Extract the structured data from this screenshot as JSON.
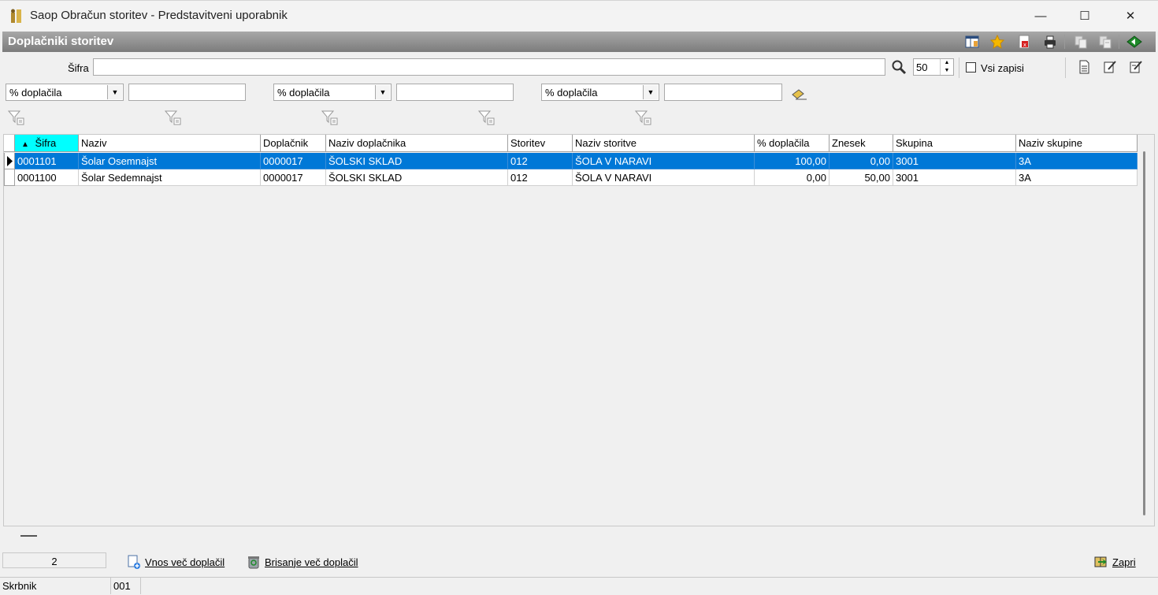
{
  "window": {
    "title": "Saop Obračun storitev - Predstavitveni uporabnik",
    "minimize_glyph": "—",
    "maximize_glyph": "☐",
    "close_glyph": "✕"
  },
  "header": {
    "title": "Doplačniki storitev"
  },
  "search": {
    "label": "Šifra",
    "value": "",
    "count": "50",
    "all_records_label": "Vsi zapisi"
  },
  "filters": [
    {
      "field": "% doplačila",
      "value": ""
    },
    {
      "field": "% doplačila",
      "value": ""
    },
    {
      "field": "% doplačila",
      "value": ""
    }
  ],
  "table": {
    "columns": [
      "Šifra",
      "Naziv",
      "Doplačnik",
      "Naziv doplačnika",
      "Storitev",
      "Naziv storitve",
      "% doplačila",
      "Znesek",
      "Skupina",
      "Naziv skupine"
    ],
    "sort_glyph": "▲",
    "rows": [
      [
        "0001101",
        "Šolar Osemnajst",
        "0000017",
        "ŠOLSKI SKLAD",
        "012",
        "ŠOLA V NARAVI",
        "100,00",
        "0,00",
        "3001",
        "3A"
      ],
      [
        "0001100",
        "Šolar Sedemnajst",
        "0000017",
        "ŠOLSKI SKLAD",
        "012",
        "ŠOLA V NARAVI",
        "0,00",
        "50,00",
        "3001",
        "3A"
      ]
    ]
  },
  "footer": {
    "record_count": "2",
    "vnos_label": "Vnos več doplačil",
    "brisanje_label": "Brisanje več doplačil",
    "zapri_label": "Zapri"
  },
  "statusbar": {
    "label": "Skrbnik",
    "value": "001"
  },
  "colors": {
    "selection": "#0078d7",
    "sort_header": "#00ffff",
    "band": "#8c8c8c"
  }
}
